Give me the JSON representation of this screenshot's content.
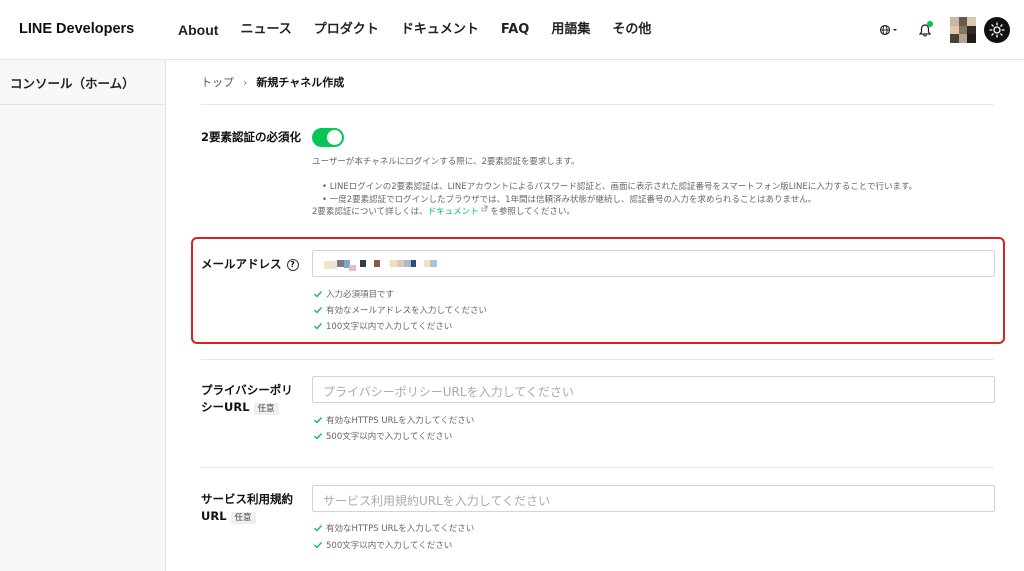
{
  "header": {
    "logo": "LINE Developers",
    "nav": [
      "About",
      "ニュース",
      "プロダクト",
      "ドキュメント",
      "FAQ",
      "用語集",
      "その他"
    ]
  },
  "sidebar": {
    "items": [
      {
        "label": "コンソール（ホーム）"
      }
    ]
  },
  "breadcrumb": {
    "top": "トップ",
    "separator": "›",
    "current": "新規チャネル作成"
  },
  "twofa": {
    "label": "2要素認証の必須化",
    "enabled": true,
    "description": "ユーザーが本チャネルにログインする際に、2要素認証を要求します。",
    "bullets": [
      "LINEログインの2要素認証は、LINEアカウントによるパスワード認証と、画面に表示された認証番号をスマートフォン版LINEに入力することで行います。",
      "一度2要素認証でログインしたブラウザでは、1年間は信頼済み状態が継続し、認証番号の入力を求められることはありません。"
    ],
    "more_prefix": "2要素認証について詳しくは、",
    "more_link": "ドキュメント",
    "more_suffix": " を参照してください。"
  },
  "email": {
    "label": "メールアドレス",
    "help_icon": "?",
    "checks": [
      "入力必須項目です",
      "有効なメールアドレスを入力してください",
      "100文字以内で入力してください"
    ]
  },
  "privacy": {
    "label_line1": "プライバシーポリ",
    "label_line2": "シーURL",
    "optional": "任意",
    "placeholder": "プライバシーポリシーURLを入力してください",
    "checks": [
      "有効なHTTPS URLを入力してください",
      "500文字以内で入力してください"
    ]
  },
  "terms": {
    "label_line1": "サービス利用規約",
    "label_line2": "URL",
    "optional": "任意",
    "placeholder": "サービス利用規約URLを入力してください",
    "checks": [
      "有効なHTTPS URLを入力してください",
      "500文字以内で入力してください"
    ]
  },
  "colors": {
    "accent": "#06c755",
    "highlight": "#d9231f"
  }
}
